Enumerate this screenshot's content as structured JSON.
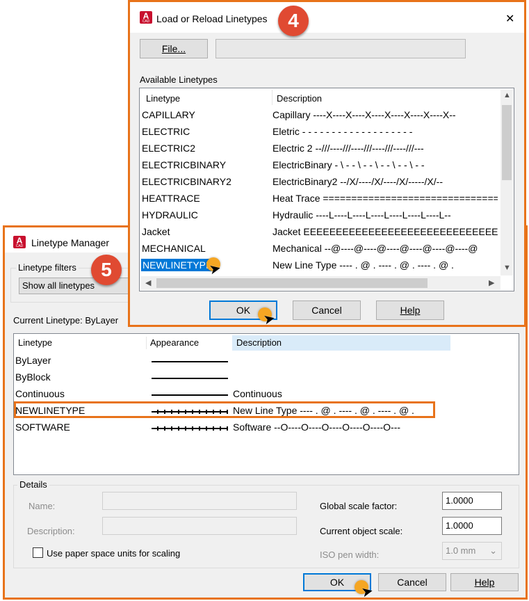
{
  "linetype_manager": {
    "title": "Linetype Manager",
    "filters_group": "Linetype filters",
    "filter_value": "Show all linetypes",
    "current_linetype": "Current Linetype:  ByLayer",
    "columns": [
      "Linetype",
      "Appearance",
      "Description"
    ],
    "rows": [
      {
        "name": "ByLayer",
        "appearance": "solid",
        "description": ""
      },
      {
        "name": "ByBlock",
        "appearance": "solid",
        "description": ""
      },
      {
        "name": "Continuous",
        "appearance": "solid",
        "description": "Continuous"
      },
      {
        "name": "NEWLINETYPE",
        "appearance": "dotted",
        "description": "New Line Type ---- . @ . ---- . @ . ---- . @ ."
      },
      {
        "name": "SOFTWARE",
        "appearance": "dotted",
        "description": "Software --O----O----O----O----O----O---"
      }
    ],
    "details": {
      "group": "Details",
      "name_label": "Name:",
      "description_label": "Description:",
      "paper_space_label": "Use paper space units for scaling",
      "global_scale_label": "Global scale factor:",
      "global_scale_value": "1.0000",
      "object_scale_label": "Current object scale:",
      "object_scale_value": "1.0000",
      "iso_pen_label": "ISO pen width:",
      "iso_pen_value": "1.0 mm"
    },
    "buttons": {
      "ok": "OK",
      "cancel": "Cancel",
      "help": "Help"
    },
    "step": "5"
  },
  "load_dialog": {
    "title": "Load or Reload Linetypes",
    "close": "✕",
    "file_button": "File...",
    "file_path": "",
    "available_label": "Available Linetypes",
    "columns": [
      "Linetype",
      "Description"
    ],
    "rows": [
      {
        "name": "CAPILLARY",
        "description": "Capillary ----X----X----X----X----X----X----X--"
      },
      {
        "name": "ELECTRIC",
        "description": "Eletric - - - - - - - - - - - - - - - - - - -"
      },
      {
        "name": "ELECTRIC2",
        "description": "Electric 2 --///----///----///----///----///---"
      },
      {
        "name": "ELECTRICBINARY",
        "description": "ElectricBinary - \\ - - \\ - - \\ - - \\ - - \\ - -"
      },
      {
        "name": "ELECTRICBINARY2",
        "description": "ElectricBinary2 --/X/----/X/----/X/-----/X/--"
      },
      {
        "name": "HEATTRACE",
        "description": "Heat Trace ==============================="
      },
      {
        "name": "HYDRAULIC",
        "description": "Hydraulic ----L----L----L----L----L----L----L--"
      },
      {
        "name": "Jacket",
        "description": "Jacket EEEEEEEEEEEEEEEEEEEEEEEEEEEEEEEEEEEE"
      },
      {
        "name": "MECHANICAL",
        "description": "Mechanical --@----@----@----@----@----@----@"
      },
      {
        "name": "NEWLINETYPE",
        "description": "New Line Type ---- . @ . ---- . @ . ---- . @ ."
      }
    ],
    "buttons": {
      "ok": "OK",
      "cancel": "Cancel",
      "help": "Help"
    },
    "step": "4"
  },
  "colors": {
    "highlight": "#e8731a",
    "selection": "#0078d7",
    "badge": "#e04a32",
    "click": "#f5a623"
  }
}
